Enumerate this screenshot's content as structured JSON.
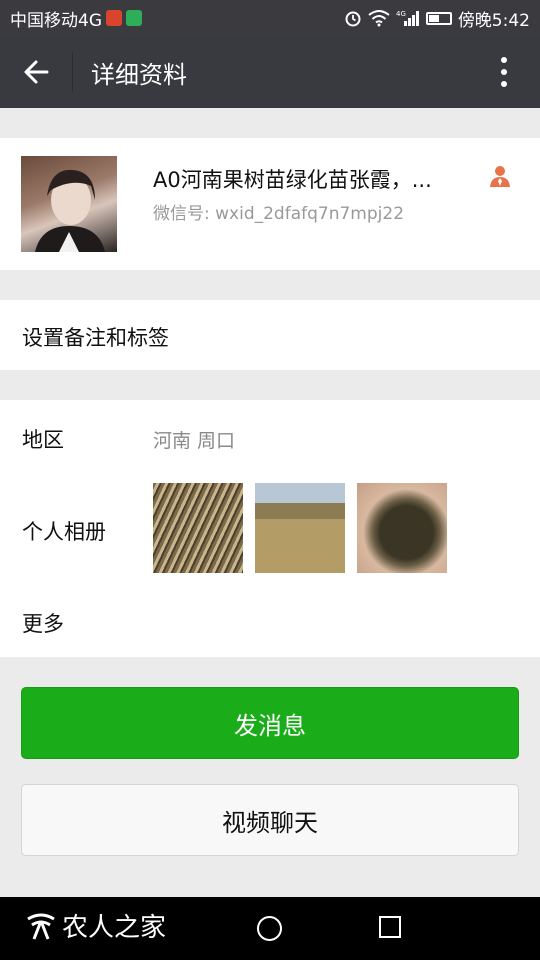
{
  "status_bar": {
    "carrier": "中国移动4G",
    "time": "傍晚5:42",
    "signal_label": "4G",
    "battery_level": 0.45
  },
  "header": {
    "title": "详细资料",
    "back_icon": "arrow-left-icon",
    "more_icon": "more-vertical-icon"
  },
  "profile": {
    "name": "A0河南果树苗绿化苗张霞，...",
    "wechat_id": "微信号: wxid_2dfafq7n7mpj22",
    "contact_icon_color": "#e8734a"
  },
  "settings": {
    "remark_label": "设置备注和标签"
  },
  "info": {
    "region_label": "地区",
    "region_value": "河南  周口",
    "album_label": "个人相册",
    "more_label": "更多"
  },
  "actions": {
    "send_message": "发消息",
    "video_chat": "视频聊天"
  },
  "nav_bar": {
    "brand_text": "农人之家"
  },
  "colors": {
    "header_bg": "#393a3f",
    "primary_green": "#1aad19",
    "page_bg": "#ebebeb"
  }
}
